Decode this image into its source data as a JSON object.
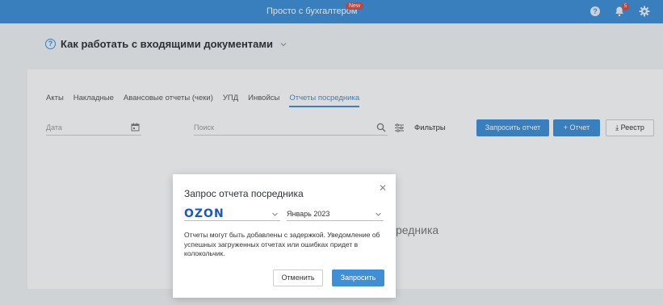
{
  "topbar": {
    "promo_text": "Просто с бухгалтером",
    "promo_badge": "New",
    "help_glyph": "?",
    "notification_count": "5",
    "icons": [
      "help-icon",
      "bell-icon",
      "gear-icon"
    ]
  },
  "page": {
    "title": "Как работать с входящими документами",
    "help_glyph": "?"
  },
  "tabs": [
    {
      "label": "Акты",
      "active": false
    },
    {
      "label": "Накладные",
      "active": false
    },
    {
      "label": "Авансовые отчеты (чеки)",
      "active": false
    },
    {
      "label": "УПД",
      "active": false
    },
    {
      "label": "Инвойсы",
      "active": false
    },
    {
      "label": "Отчеты посредника",
      "active": true
    }
  ],
  "toolbar": {
    "date_placeholder": "Дата",
    "search_placeholder": "Поиск",
    "filters_label": "Фильтры",
    "request_report_label": "Запросить отчет",
    "add_report_label": "+ Отчет",
    "registry_label": "Реестр"
  },
  "empty_hint": "редника",
  "modal": {
    "title": "Запрос отчета посредника",
    "close_glyph": "✕",
    "marketplace_value": "OZON",
    "period_value": "Январь 2023",
    "note": "Отчеты могут быть добавлены с задержкой. Уведомление об успешных загруженных отчетах или ошибках придет в колокольчик.",
    "cancel_label": "Отменить",
    "submit_label": "Запросить"
  },
  "colors": {
    "accent": "#3e8fd6",
    "badge": "#e04a3a",
    "ozon_brand": "#1a57c8"
  }
}
